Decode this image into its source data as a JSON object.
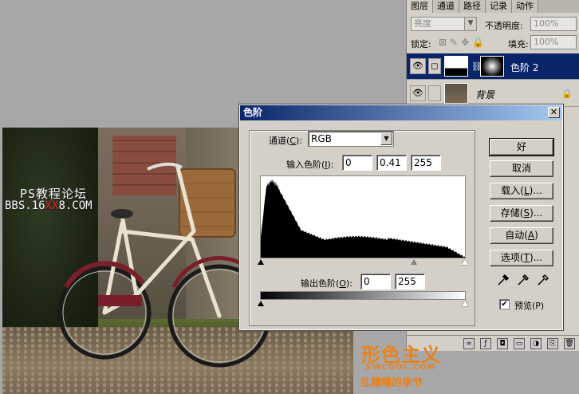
{
  "photo": {
    "watermark_line1": "PS教程论坛",
    "watermark_line2_pre": "BBS.16",
    "watermark_line2_hl": "XX",
    "watermark_line2_post": "8.COM"
  },
  "layers_panel": {
    "tabs": [
      "图层",
      "通道",
      "路径",
      "记录",
      "动作"
    ],
    "blend_mode": "亮度",
    "opacity_label": "不透明度:",
    "opacity_value": "100%",
    "lock_label": "锁定:",
    "fill_label": "填充:",
    "fill_value": "100%",
    "layers": [
      {
        "name": "色阶 2",
        "selected": true
      },
      {
        "name": "背景",
        "selected": false
      }
    ]
  },
  "levels_dialog": {
    "title": "色阶",
    "channel_label_pre": "通道(",
    "channel_label_key": "C",
    "channel_label_post": "):",
    "channel_value": "RGB",
    "input_label_pre": "输入色阶(",
    "input_label_key": "I",
    "input_label_post": "):",
    "input_values": [
      "0",
      "0.41",
      "255"
    ],
    "output_label_pre": "输出色阶(",
    "output_label_key": "O",
    "output_label_post": "):",
    "output_values": [
      "0",
      "255"
    ],
    "buttons": [
      {
        "pre": "好",
        "key": "",
        "post": ""
      },
      {
        "pre": "取消",
        "key": "",
        "post": ""
      },
      {
        "pre": "载入(",
        "key": "L",
        "post": ")..."
      },
      {
        "pre": "存储(",
        "key": "S",
        "post": ")..."
      },
      {
        "pre": "自动(",
        "key": "A",
        "post": ")"
      },
      {
        "pre": "选项(",
        "key": "T",
        "post": ")..."
      }
    ],
    "preview_label": "预览(P)",
    "preview_checked": true
  },
  "logo": {
    "brand": "形色主义",
    "site": "SWCOOL.COM",
    "sub": "乱糟糟的季节"
  }
}
